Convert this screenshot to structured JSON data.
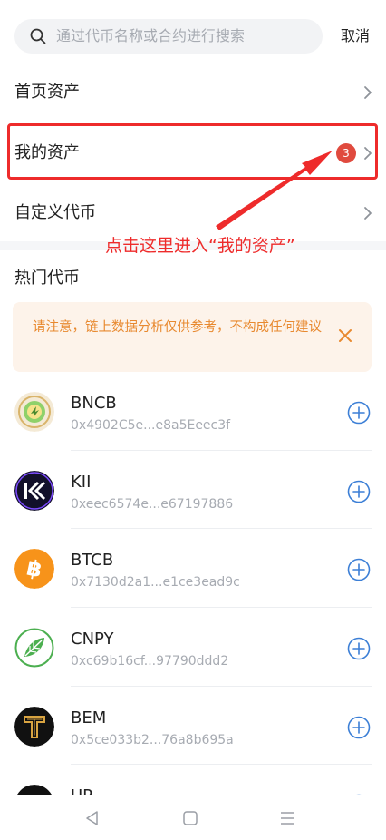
{
  "search": {
    "placeholder": "通过代币名称或合约进行搜索",
    "cancel_label": "取消"
  },
  "menu": [
    {
      "label": "首页资产"
    },
    {
      "label": "我的资产",
      "badge": "3"
    },
    {
      "label": "自定义代币"
    }
  ],
  "annotation": {
    "text": "点击这里进入“我的资产”",
    "color": "#ee2b2b"
  },
  "hot": {
    "title": "热门代币"
  },
  "notice": {
    "text": "请注意，链上数据分析仅供参考，不构成任何建议",
    "color": "#e8892f"
  },
  "tokens": [
    {
      "symbol": "BNCB",
      "address": "0x4902C5e...e8a5Eeec3f",
      "icon": "bncb-logo"
    },
    {
      "symbol": "KII",
      "address": "0xeec6574e...e67197886",
      "icon": "kii-logo"
    },
    {
      "symbol": "BTCB",
      "address": "0x7130d2a1...e1ce3ead9c",
      "icon": "bitcoin-logo"
    },
    {
      "symbol": "CNPY",
      "address": "0xc69b16cf...97790ddd2",
      "icon": "cnpy-logo"
    },
    {
      "symbol": "BEM",
      "address": "0x5ce033b2...76a8b695a",
      "icon": "bem-logo"
    },
    {
      "symbol": "UP",
      "address": "",
      "icon": "up-logo"
    }
  ],
  "colors": {
    "accent": "#3c7fd6",
    "badge": "#e04a3e"
  }
}
